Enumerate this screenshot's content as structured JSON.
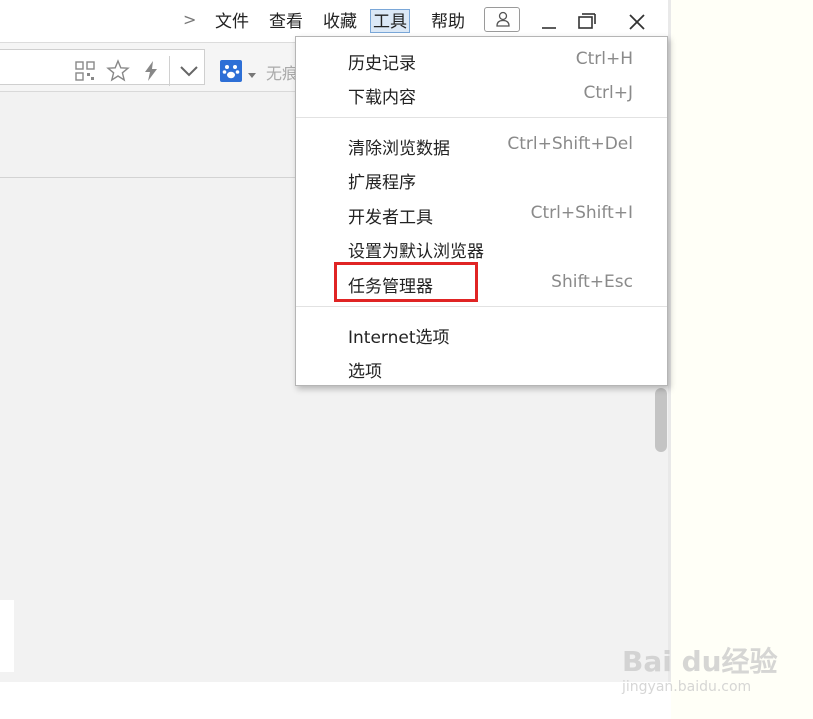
{
  "menubar": {
    "overflow_chevron": ">",
    "items": [
      {
        "label": "文件"
      },
      {
        "label": "查看"
      },
      {
        "label": "收藏"
      },
      {
        "label": "工具",
        "active": true
      },
      {
        "label": "帮助"
      }
    ]
  },
  "toolbar": {
    "search_placeholder": "无痕"
  },
  "tools_menu": {
    "groups": [
      [
        {
          "label": "历史记录",
          "shortcut": "Ctrl+H"
        },
        {
          "label": "下载内容",
          "shortcut": "Ctrl+J"
        }
      ],
      [
        {
          "label": "清除浏览数据",
          "shortcut": "Ctrl+Shift+Del"
        },
        {
          "label": "扩展程序",
          "shortcut": ""
        },
        {
          "label": "开发者工具",
          "shortcut": "Ctrl+Shift+I"
        },
        {
          "label": "设置为默认浏览器",
          "shortcut": ""
        },
        {
          "label": "任务管理器",
          "shortcut": "Shift+Esc",
          "highlighted": true
        }
      ],
      [
        {
          "label": "Internet选项",
          "shortcut": ""
        },
        {
          "label": "选项",
          "shortcut": ""
        }
      ]
    ]
  },
  "watermark": {
    "brand": "Bai du经验",
    "url": "jingyan.baidu.com"
  },
  "colors": {
    "highlight": "#e02424",
    "active_menu_bg": "#dbe8f6",
    "search_engine": "#2d6fd6"
  }
}
